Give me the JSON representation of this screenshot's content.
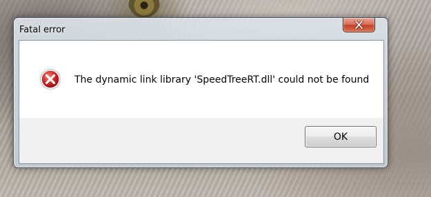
{
  "dialog": {
    "title": "Fatal error",
    "message": "The dynamic link library 'SpeedTreeRT.dll' could not be found",
    "icon": "error-icon",
    "ok_label": "OK"
  },
  "colors": {
    "close_button": "#c4412a",
    "error_icon": "#d02a2a",
    "message_background": "#ffffff",
    "button_area_background": "#f0f0f0"
  }
}
